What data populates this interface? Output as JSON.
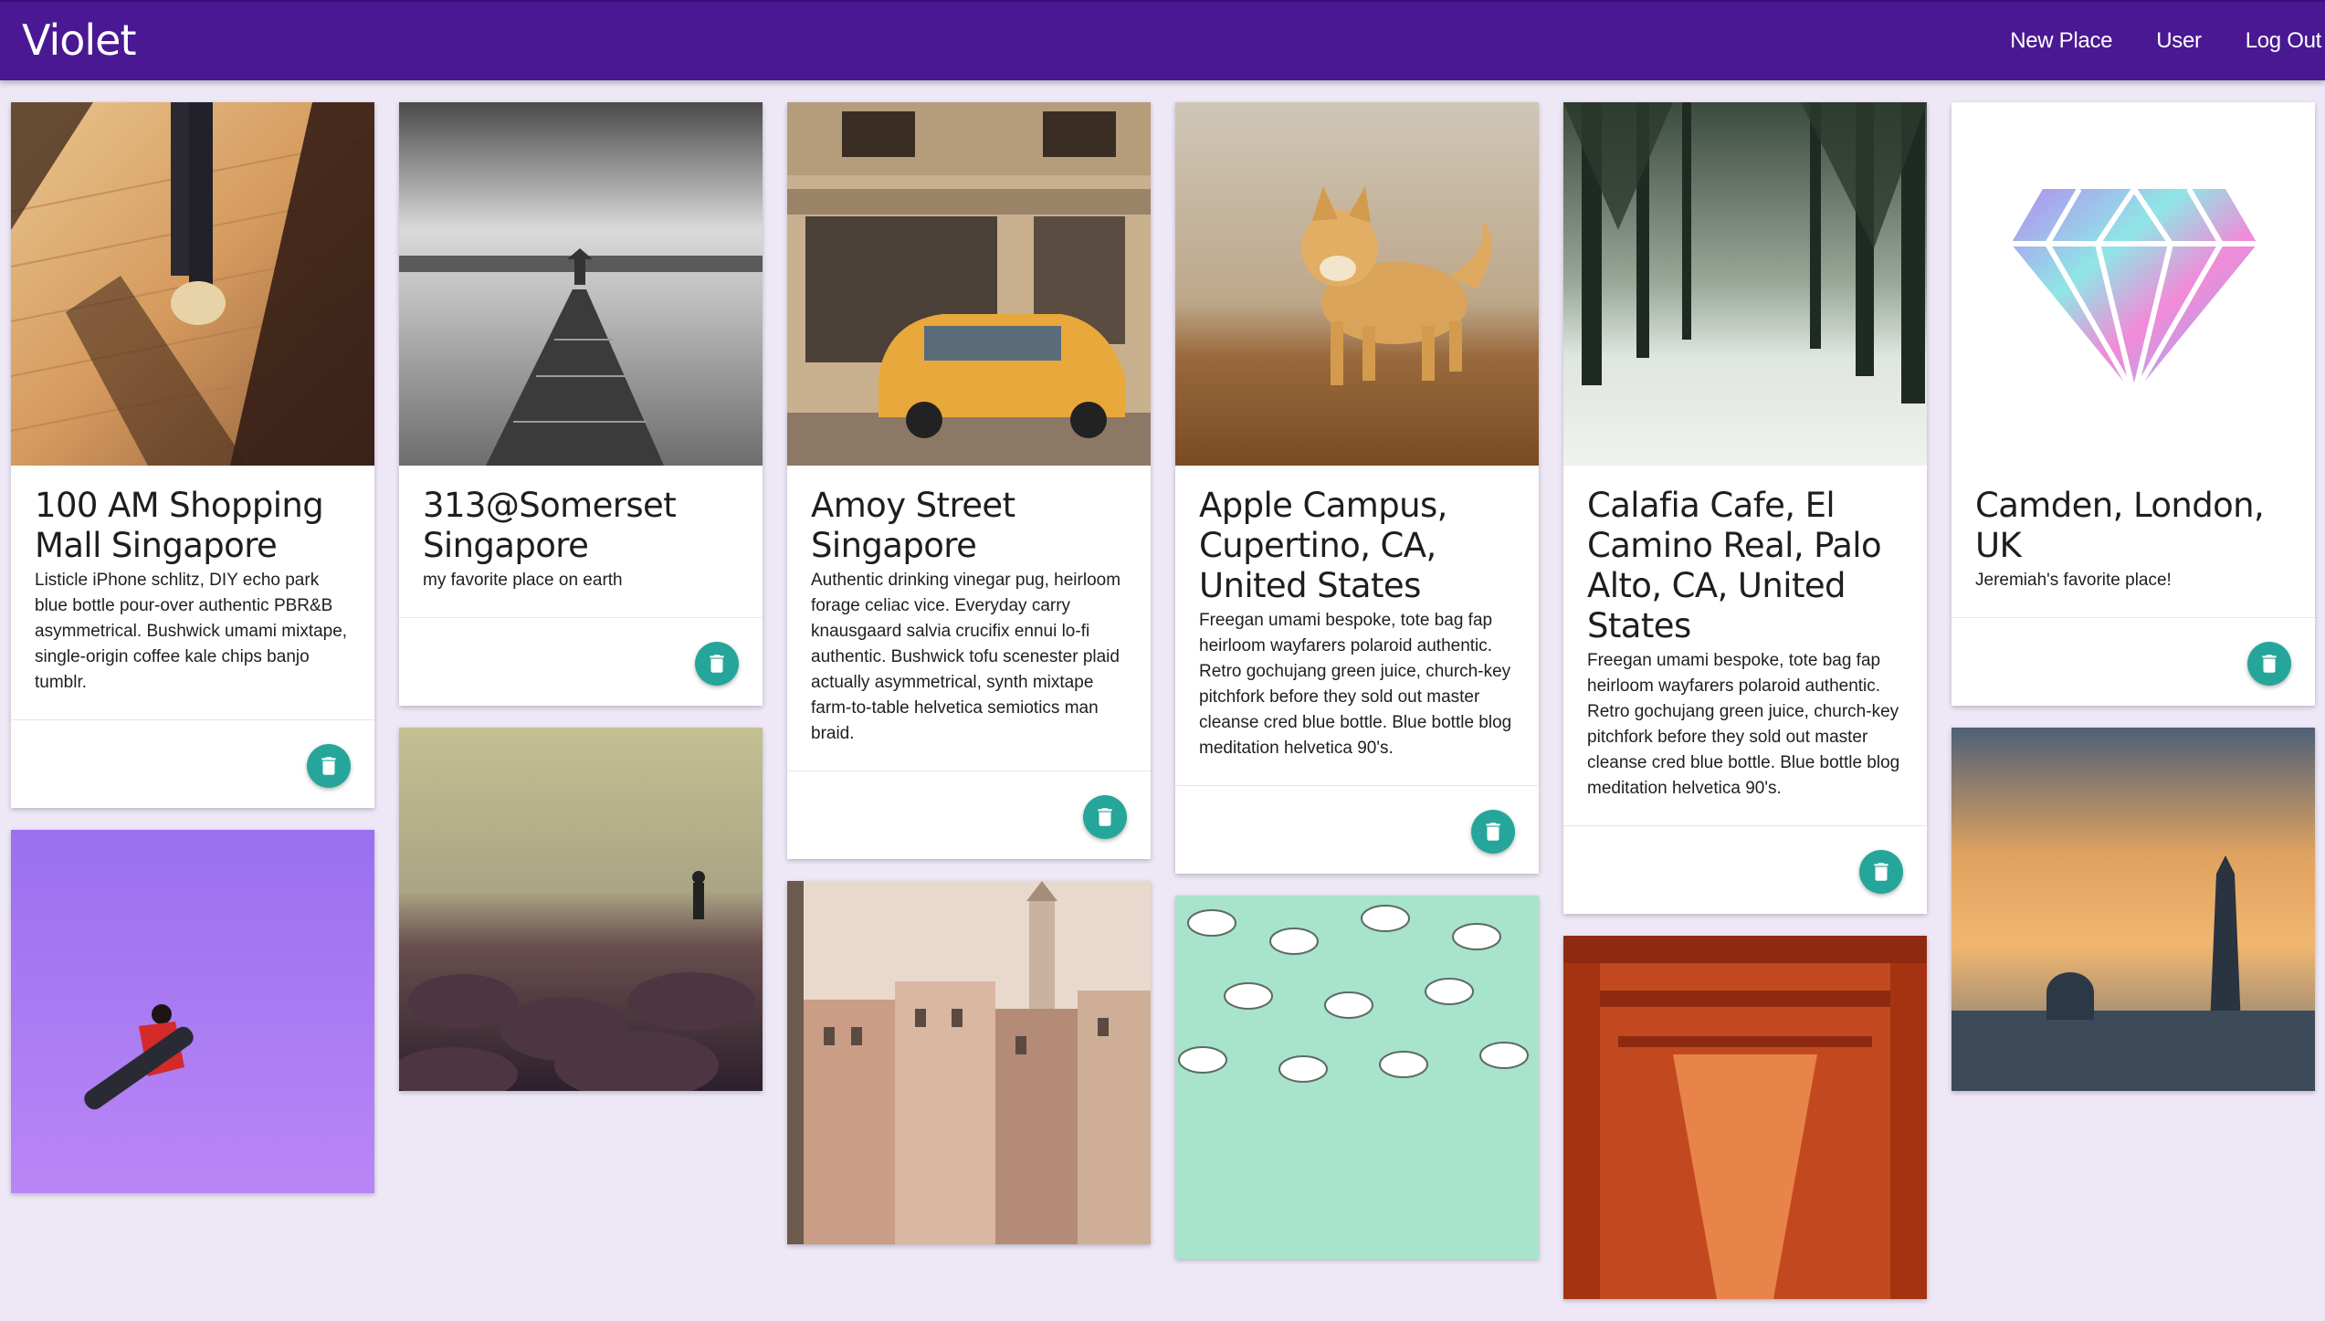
{
  "app": {
    "brand": "Violet"
  },
  "nav": {
    "new_place": "New Place",
    "user": "User",
    "logout": "Log Out"
  },
  "colors": {
    "header": "#4a1893",
    "background": "#ede7f6",
    "fab": "#26a69a"
  },
  "places": [
    {
      "image_icon": "photo-wooden-deck-shadow",
      "title": "100 AM Shopping Mall Singapore",
      "description": "Listicle iPhone schlitz, DIY echo park blue bottle pour-over authentic PBR&B asymmetrical. Bushwick umami mixtape, single-origin coffee kale chips banjo tumblr.",
      "action_icon": "trash-icon"
    },
    {
      "image_icon": "photo-pier-black-white",
      "title": "313@Somerset Singapore",
      "description": "my favorite place on earth",
      "action_icon": "trash-icon"
    },
    {
      "image_icon": "photo-yellow-car-boulangerie",
      "title": "Amoy Street Singapore",
      "description": "Authentic drinking vinegar pug, heirloom forage celiac vice. Everyday carry knausgaard salvia crucifix ennui lo-fi authentic. Bushwick tofu scenester plaid actually asymmetrical, synth mixtape farm-to-table helvetica semiotics man braid.",
      "action_icon": "trash-icon"
    },
    {
      "image_icon": "photo-shiba-dog-beach",
      "title": "Apple Campus, Cupertino, CA, United States",
      "description": "Freegan umami bespoke, tote bag fap heirloom wayfarers polaroid authentic. Retro gochujang green juice, church-key pitchfork before they sold out master cleanse cred blue bottle. Blue bottle blog meditation helvetica 90's.",
      "action_icon": "trash-icon"
    },
    {
      "image_icon": "photo-snowy-forest",
      "title": "Calafia Cafe, El Camino Real, Palo Alto, CA, United States",
      "description": "Freegan umami bespoke, tote bag fap heirloom wayfarers polaroid authentic. Retro gochujang green juice, church-key pitchfork before they sold out master cleanse cred blue bottle. Blue bottle blog meditation helvetica 90's.",
      "action_icon": "trash-icon"
    },
    {
      "image_icon": "photo-rainbow-diamond",
      "title": "Camden, London, UK",
      "description": "Jeremiah's favorite place!",
      "action_icon": "trash-icon"
    }
  ],
  "partial_cards": [
    {
      "image_icon": "photo-snowboarder-purple-sky"
    },
    {
      "image_icon": "photo-rocky-shore-person"
    },
    {
      "image_icon": "photo-venice-buildings"
    },
    {
      "image_icon": "photo-cats-pattern-mint"
    },
    {
      "image_icon": "photo-torii-gates-tunnel"
    },
    {
      "image_icon": "photo-paris-eiffel-tower"
    }
  ]
}
